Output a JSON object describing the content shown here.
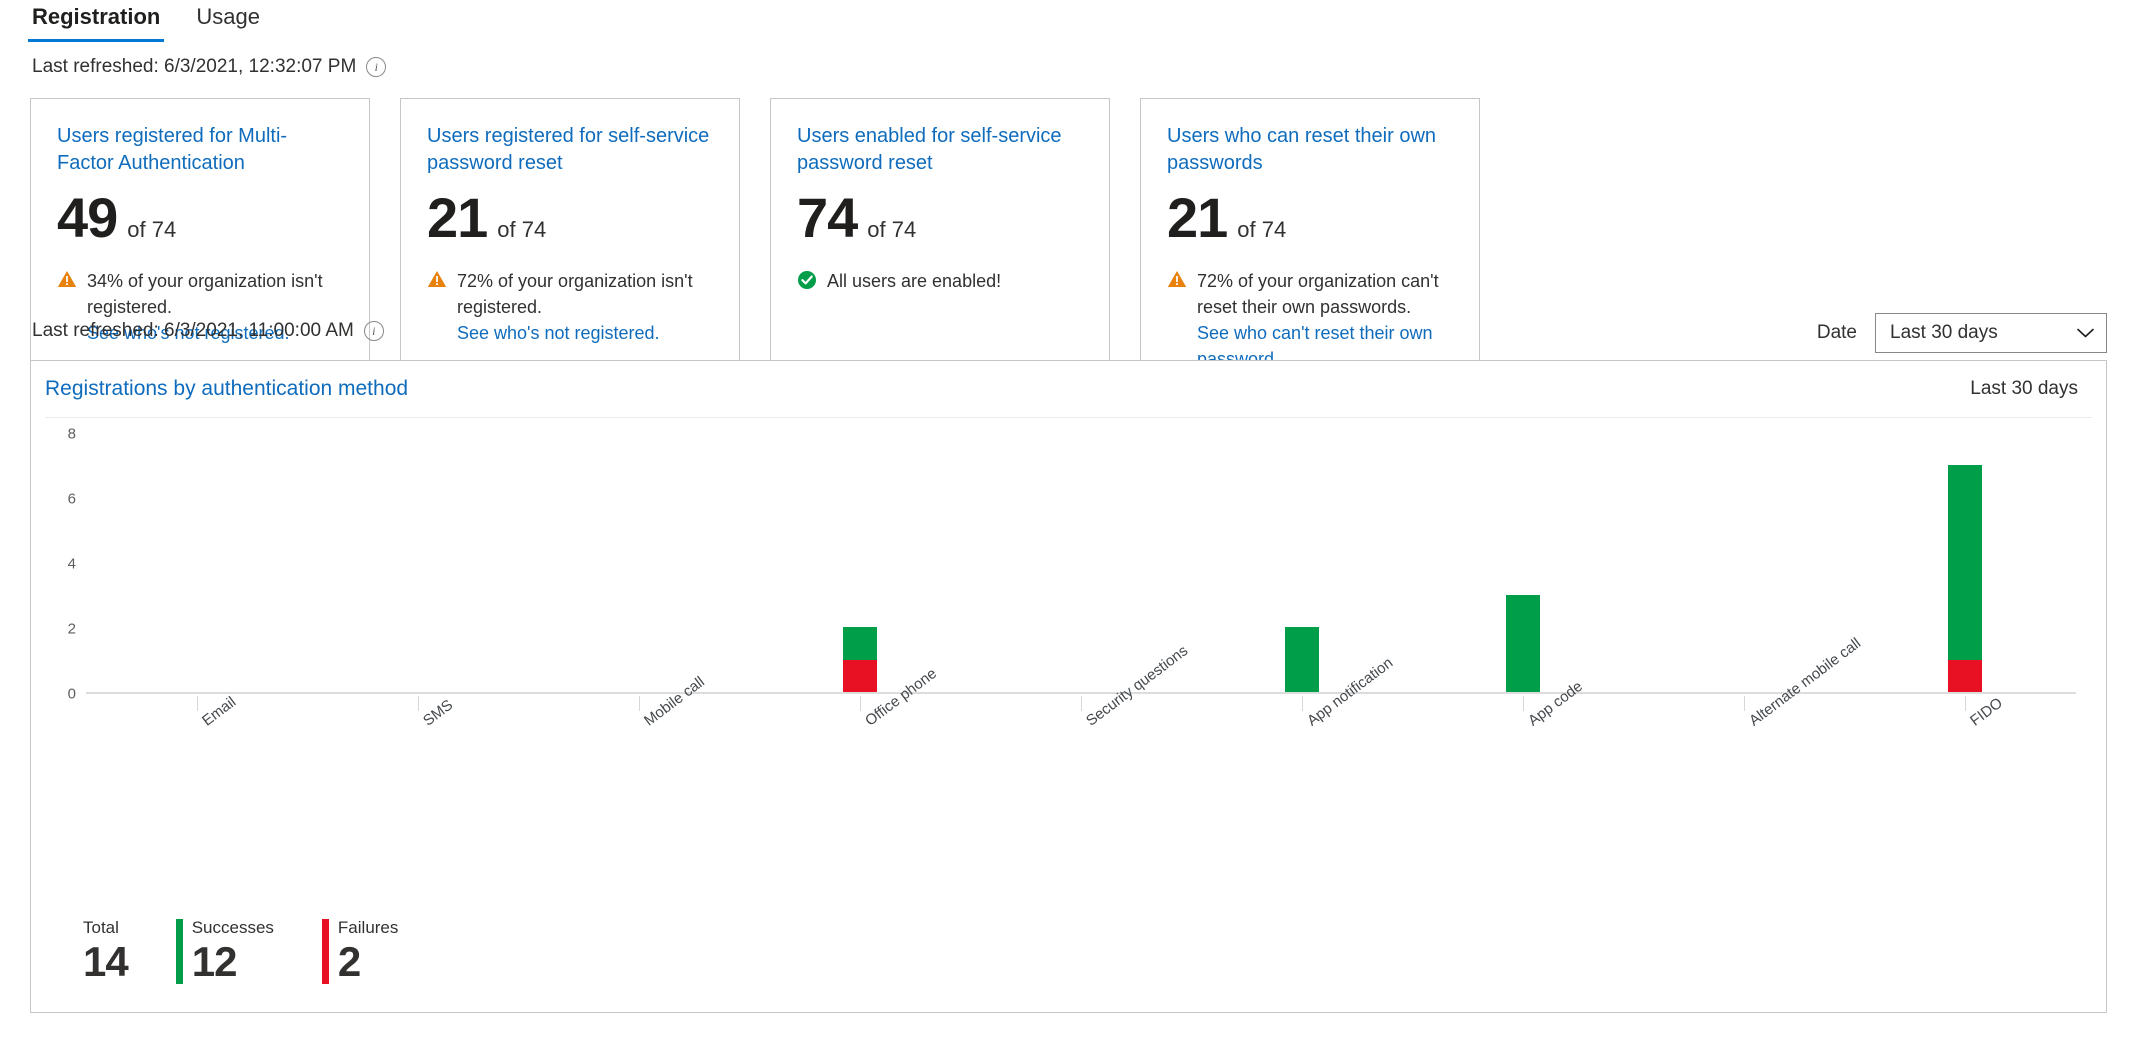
{
  "tabs": [
    {
      "label": "Registration",
      "active": true
    },
    {
      "label": "Usage",
      "active": false
    }
  ],
  "refresh_top": {
    "text": "Last refreshed: 6/3/2021, 12:32:07 PM",
    "info_glyph": "i"
  },
  "refresh_chart": {
    "text": "Last refreshed: 6/3/2021, 11:00:00 AM",
    "info_glyph": "i"
  },
  "cards": [
    {
      "title": "Users registered for Multi-Factor Authentication",
      "value": "49",
      "of": "of 74",
      "status": "warning",
      "note": "34% of your organization isn't registered.",
      "link": "See who's not registered."
    },
    {
      "title": "Users registered for self-service password reset",
      "value": "21",
      "of": "of 74",
      "status": "warning",
      "note": "72% of your organization isn't registered.",
      "link": "See who's not registered."
    },
    {
      "title": "Users enabled for self-service password reset",
      "value": "74",
      "of": "of 74",
      "status": "ok",
      "note": "All users are enabled!",
      "link": ""
    },
    {
      "title": "Users who can reset their own passwords",
      "value": "21",
      "of": "of 74",
      "status": "warning",
      "note": "72% of your organization can't reset their own passwords.",
      "link": "See who can't reset their own password."
    }
  ],
  "date_filter": {
    "label": "Date",
    "value": "Last 30 days",
    "chevron_icon": "chevron-down-icon"
  },
  "chart_panel": {
    "title": "Registrations by authentication method",
    "range": "Last 30 days"
  },
  "chart_data": {
    "type": "bar",
    "title": "Registrations by authentication method",
    "xlabel": "",
    "ylabel": "",
    "ylim": [
      0,
      8
    ],
    "yticks": [
      0,
      2,
      4,
      6,
      8
    ],
    "grid": false,
    "legend_position": "bottom-left",
    "stacked": true,
    "categories": [
      "Email",
      "SMS",
      "Mobile call",
      "Office phone",
      "Security questions",
      "App notification",
      "App code",
      "Alternate mobile call",
      "FIDO"
    ],
    "series": [
      {
        "name": "Successes",
        "color": "#009e49",
        "values": [
          0,
          0,
          0,
          1,
          0,
          2,
          3,
          0,
          6
        ]
      },
      {
        "name": "Failures",
        "color": "#e81123",
        "values": [
          0,
          0,
          0,
          1,
          0,
          0,
          0,
          0,
          1
        ]
      }
    ]
  },
  "totals": [
    {
      "label": "Total",
      "value": "14",
      "swatch": "none"
    },
    {
      "label": "Successes",
      "value": "12",
      "swatch": "success"
    },
    {
      "label": "Failures",
      "value": "2",
      "swatch": "failure"
    }
  ],
  "colors": {
    "accent": "#0078d4",
    "link": "#0f6cbd",
    "success": "#009e49",
    "failure": "#e81123",
    "warning": "#e8820c"
  }
}
